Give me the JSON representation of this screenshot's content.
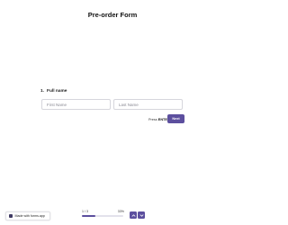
{
  "form": {
    "title": "Pre-order Form"
  },
  "question": {
    "number": "1.",
    "label": "Full name",
    "first_name_placeholder": "First Name",
    "last_name_placeholder": "Last Name"
  },
  "submit": {
    "hint_prefix": "Press",
    "hint_key": "ENTER",
    "button_label": "Next"
  },
  "footer": {
    "made_with_label": "Made with forms.app",
    "progress_count": "1 / 3",
    "progress_percent": "33%",
    "progress_value": 0.33,
    "up_icon": "chevron-up-icon",
    "down_icon": "chevron-down-icon"
  },
  "colors": {
    "accent": "#5c4f9e",
    "border": "#d6d6dc",
    "text": "#1f1f1f"
  }
}
